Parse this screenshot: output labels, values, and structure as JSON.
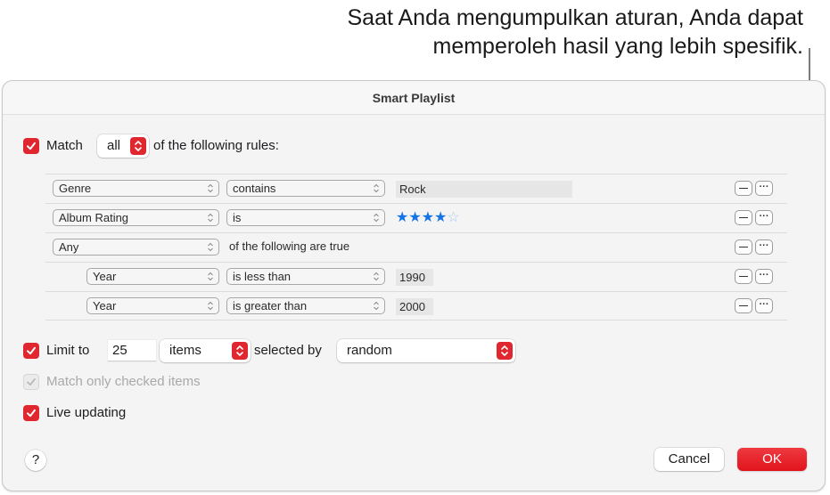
{
  "callout": {
    "line1": "Saat Anda mengumpulkan aturan, Anda dapat",
    "line2": "memperoleh hasil yang lebih spesifik."
  },
  "dialog": {
    "title": "Smart Playlist",
    "match": {
      "checked": true,
      "label": "Match",
      "mode": "all",
      "suffix": "of the following rules:"
    },
    "rules": [
      {
        "field": "Genre",
        "operator": "contains",
        "value": "Rock",
        "indent": 0
      },
      {
        "field": "Album Rating",
        "operator": "is",
        "rating": 4,
        "rating_max": 5,
        "indent": 0
      },
      {
        "field": "Any",
        "text": "of the following are true",
        "indent": 0
      },
      {
        "field": "Year",
        "operator": "is less than",
        "value": "1990",
        "indent": 1
      },
      {
        "field": "Year",
        "operator": "is greater than",
        "value": "2000",
        "indent": 1
      }
    ],
    "rule_buttons": {
      "remove_icon": "minus-icon",
      "more_icon": "ellipsis-icon"
    },
    "limit": {
      "checked": true,
      "label": "Limit to",
      "value": "25",
      "unit": "items",
      "selected_by_label": "selected by",
      "selected_by": "random"
    },
    "match_only_checked": {
      "checked": true,
      "enabled": false,
      "label": "Match only checked items"
    },
    "live_updating": {
      "checked": true,
      "label": "Live updating"
    },
    "help_label": "?",
    "cancel_label": "Cancel",
    "ok_label": "OK"
  },
  "colors": {
    "accent": "#e0272f",
    "star": "#1473e6"
  }
}
